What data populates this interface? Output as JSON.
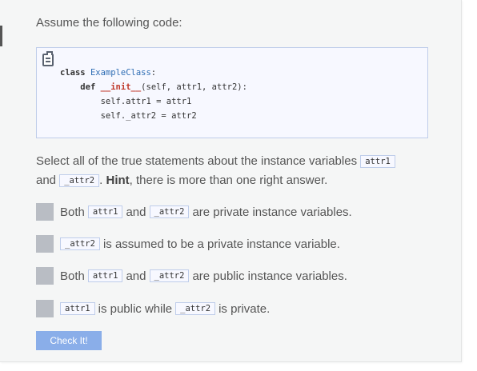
{
  "intro": "Assume the following code:",
  "code": {
    "line1_kw": "class",
    "line1_name": "ExampleClass",
    "line1_end": ":",
    "line2_kw": "def",
    "line2_fn": "__init__",
    "line2_rest": "(self, attr1, attr2):",
    "line3": "self.attr1 = attr1",
    "line4": "self._attr2 = attr2"
  },
  "prompt": {
    "text1": "Select all of the true statements about the instance variables ",
    "chip_attr1": "attr1",
    "text2": "and ",
    "chip_attr2": "_attr2",
    "text3": ". ",
    "hint": "Hint",
    "text4": ", there is more than one right answer."
  },
  "options": [
    {
      "pre": "Both",
      "chip1": "attr1",
      "mid": "and",
      "chip2": "_attr2",
      "post": "are private instance variables."
    },
    {
      "chip1": "_attr2",
      "post": "is assumed to be a private instance variable."
    },
    {
      "pre": "Both",
      "chip1": "attr1",
      "mid": "and",
      "chip2": "_attr2",
      "post": "are public instance variables."
    },
    {
      "chip1": "attr1",
      "mid": "is public while",
      "chip2": "_attr2",
      "post": "is private."
    }
  ],
  "check_button": "Check It!",
  "colors": {
    "accent": "#8aaee9",
    "checkbox": "#b9bdc4",
    "code_border": "#bfcdea"
  }
}
